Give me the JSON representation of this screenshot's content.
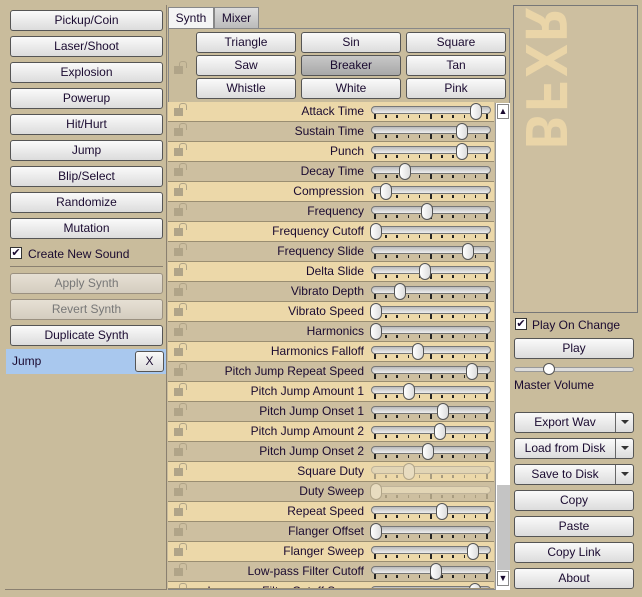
{
  "presets": [
    "Pickup/Coin",
    "Laser/Shoot",
    "Explosion",
    "Powerup",
    "Hit/Hurt",
    "Jump",
    "Blip/Select",
    "Randomize",
    "Mutation"
  ],
  "create_new_sound": {
    "label": "Create New Sound",
    "checked": true
  },
  "apply_synth": "Apply Synth",
  "revert_synth": "Revert Synth",
  "duplicate_synth": "Duplicate Synth",
  "sound_list": [
    {
      "name": "Jump",
      "remove": "X"
    }
  ],
  "tabs": [
    {
      "label": "Synth",
      "active": true
    },
    {
      "label": "Mixer",
      "active": false
    }
  ],
  "waveforms": [
    {
      "label": "Triangle"
    },
    {
      "label": "Sin"
    },
    {
      "label": "Square"
    },
    {
      "label": "Saw"
    },
    {
      "label": "Breaker",
      "selected": true
    },
    {
      "label": "Tan"
    },
    {
      "label": "Whistle"
    },
    {
      "label": "White"
    },
    {
      "label": "Pink"
    }
  ],
  "sliders": [
    {
      "label": "Attack Time",
      "value": 0.93
    },
    {
      "label": "Sustain Time",
      "value": 0.8
    },
    {
      "label": "Punch",
      "value": 0.8
    },
    {
      "label": "Decay Time",
      "value": 0.27
    },
    {
      "label": "Compression",
      "value": 0.09
    },
    {
      "label": "Frequency",
      "value": 0.47
    },
    {
      "label": "Frequency Cutoff",
      "value": 0
    },
    {
      "label": "Frequency Slide",
      "value": 0.85
    },
    {
      "label": "Delta Slide",
      "value": 0.45
    },
    {
      "label": "Vibrato Depth",
      "value": 0.22
    },
    {
      "label": "Vibrato Speed",
      "value": 0
    },
    {
      "label": "Harmonics",
      "value": 0
    },
    {
      "label": "Harmonics Falloff",
      "value": 0.39
    },
    {
      "label": "Pitch Jump Repeat Speed",
      "value": 0.89
    },
    {
      "label": "Pitch Jump Amount 1",
      "value": 0.31
    },
    {
      "label": "Pitch Jump Onset 1",
      "value": 0.62
    },
    {
      "label": "Pitch Jump Amount 2",
      "value": 0.59
    },
    {
      "label": "Pitch Jump Onset 2",
      "value": 0.48
    },
    {
      "label": "Square Duty",
      "value": 0.31,
      "disabled": true
    },
    {
      "label": "Duty Sweep",
      "value": 0,
      "disabled": true
    },
    {
      "label": "Repeat Speed",
      "value": 0.61
    },
    {
      "label": "Flanger Offset",
      "value": 0
    },
    {
      "label": "Flanger Sweep",
      "value": 0.9
    },
    {
      "label": "Low-pass Filter Cutoff",
      "value": 0.56
    },
    {
      "label": "Low-pass Filter Cutoff Sweep",
      "value": 0.92
    }
  ],
  "logo": "Bfxr",
  "play_on_change": {
    "label": "Play On Change",
    "checked": true
  },
  "play": "Play",
  "master_volume": {
    "label": "Master Volume",
    "value": 0.26
  },
  "export_wav": "Export Wav",
  "load_from_disk": "Load from Disk",
  "save_to_disk": "Save to Disk",
  "copy": "Copy",
  "paste": "Paste",
  "copy_link": "Copy Link",
  "about": "About"
}
